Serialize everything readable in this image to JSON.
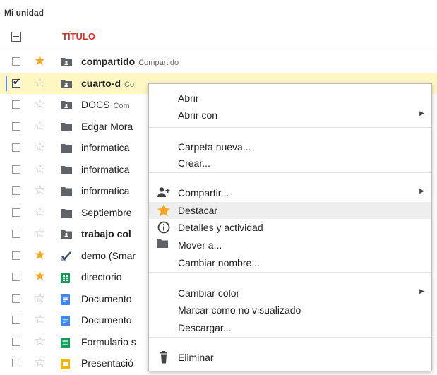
{
  "breadcrumb": "Mi unidad",
  "header": {
    "title": "TÍTULO"
  },
  "colors": {
    "accent_red": "#d93025",
    "star_yellow": "#f6a623",
    "selection": "#fff7c2",
    "sheets_green": "#0f9d58",
    "docs_blue": "#4285f4"
  },
  "rows": [
    {
      "name": "compartido",
      "tag": "Compartido",
      "starred": true,
      "checked": false,
      "icon": "shared-folder-icon",
      "bold": true
    },
    {
      "name": "cuarto-d",
      "tag": "Co",
      "starred": false,
      "checked": true,
      "icon": "shared-folder-icon",
      "bold": true
    },
    {
      "name": "DOCS",
      "tag": "Com",
      "starred": false,
      "checked": false,
      "icon": "shared-folder-icon",
      "bold": false
    },
    {
      "name": "Edgar Mora",
      "tag": "",
      "starred": false,
      "checked": false,
      "icon": "folder-icon",
      "bold": false
    },
    {
      "name": "informatica",
      "tag": "",
      "starred": false,
      "checked": false,
      "icon": "folder-icon",
      "bold": false
    },
    {
      "name": "informatica",
      "tag": "",
      "starred": false,
      "checked": false,
      "icon": "folder-icon",
      "bold": false
    },
    {
      "name": "informatica",
      "tag": "",
      "starred": false,
      "checked": false,
      "icon": "folder-icon",
      "bold": false
    },
    {
      "name": "Septiembre",
      "tag": "",
      "starred": false,
      "checked": false,
      "icon": "folder-icon",
      "bold": false
    },
    {
      "name": "trabajo col",
      "tag": "",
      "starred": false,
      "checked": false,
      "icon": "shared-folder-icon",
      "bold": true
    },
    {
      "name": "demo (Smar",
      "tag": "",
      "starred": true,
      "checked": false,
      "icon": "checkmark-file-icon",
      "bold": false
    },
    {
      "name": "directorio",
      "tag": "",
      "starred": true,
      "checked": false,
      "icon": "spreadsheet-icon",
      "bold": false
    },
    {
      "name": "Documento",
      "tag": "",
      "starred": false,
      "checked": false,
      "icon": "document-icon",
      "bold": false
    },
    {
      "name": "Documento",
      "tag": "",
      "starred": false,
      "checked": false,
      "icon": "document-icon",
      "bold": false
    },
    {
      "name": "Formulario s",
      "tag": "",
      "starred": false,
      "checked": false,
      "icon": "form-icon",
      "bold": false
    },
    {
      "name": "Presentació",
      "tag": "",
      "starred": false,
      "checked": false,
      "icon": "presentation-icon",
      "bold": false
    }
  ],
  "menu": {
    "items": [
      {
        "label": "Abrir",
        "icon": "",
        "submenu": false
      },
      {
        "label": "Abrir con",
        "icon": "",
        "submenu": true
      },
      {
        "label": "Carpeta nueva...",
        "icon": "",
        "submenu": false
      },
      {
        "label": "Crear...",
        "icon": "",
        "submenu": false
      },
      {
        "label": "Compartir...",
        "icon": "add-person-icon",
        "submenu": true
      },
      {
        "label": "Destacar",
        "icon": "star-icon",
        "submenu": false,
        "highlighted": true
      },
      {
        "label": "Detalles y actividad",
        "icon": "info-icon",
        "submenu": false
      },
      {
        "label": "Mover a...",
        "icon": "folder-icon",
        "submenu": false
      },
      {
        "label": "Cambiar nombre...",
        "icon": "",
        "submenu": false
      },
      {
        "label": "Cambiar color",
        "icon": "",
        "submenu": true
      },
      {
        "label": "Marcar como no visualizado",
        "icon": "",
        "submenu": false
      },
      {
        "label": "Descargar...",
        "icon": "",
        "submenu": false
      },
      {
        "label": "Eliminar",
        "icon": "trash-icon",
        "submenu": false
      }
    ]
  }
}
